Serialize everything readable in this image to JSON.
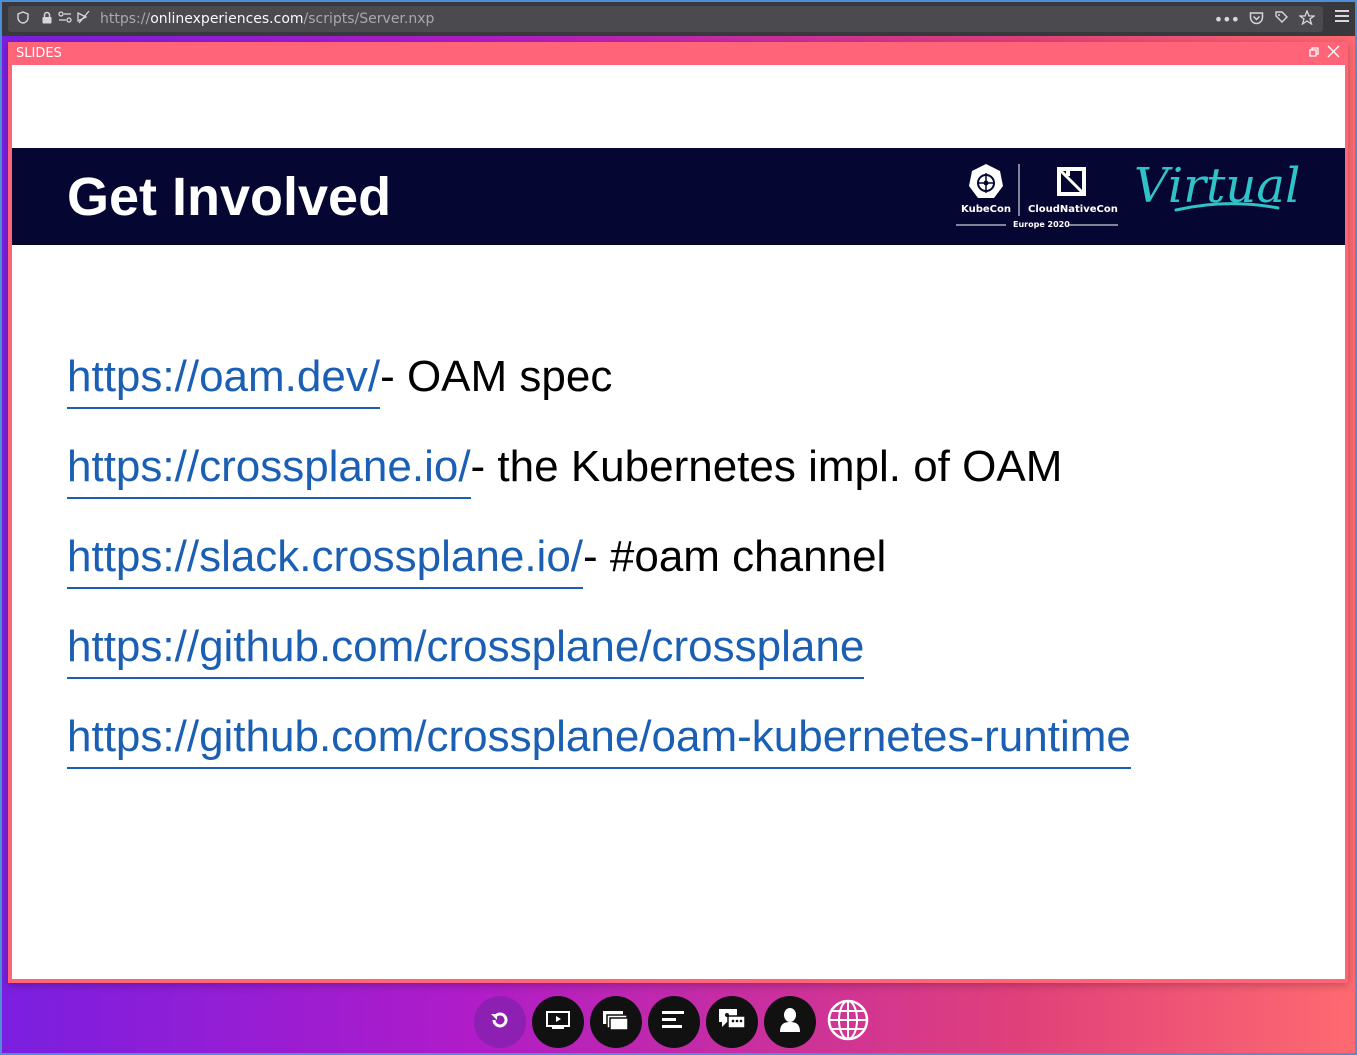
{
  "browser": {
    "url_prefix": "https://",
    "url_host": "onlinexperiences.com",
    "url_path": "/scripts/Server.nxp"
  },
  "window": {
    "title": "SLIDES"
  },
  "slide": {
    "title": "Get Involved",
    "logo": {
      "kubecon": "KubeCon",
      "cloudnativecon": "CloudNativeCon",
      "event": "Europe 2020",
      "virtual": "Virtual"
    },
    "items": [
      {
        "link": "https://oam.dev/",
        "text": "- OAM spec"
      },
      {
        "link": "https://crossplane.io/",
        "text": "- the Kubernetes impl. of OAM"
      },
      {
        "link": "https://slack.crossplane.io/",
        "text": "- #oam channel"
      },
      {
        "link": "https://github.com/crossplane/crossplane",
        "text": ""
      },
      {
        "link": "https://github.com/crossplane/oam-kubernetes-runtime",
        "text": ""
      }
    ]
  },
  "dock": {
    "buttons": [
      "refresh-icon",
      "presentation-icon",
      "slides-icon",
      "agenda-icon",
      "chat-icon",
      "profile-icon",
      "globe-icon"
    ]
  },
  "colors": {
    "slides_header": "#ff6478",
    "title_band": "#060632",
    "link": "#1a5fb4",
    "accent_teal": "#2fc3c8"
  }
}
